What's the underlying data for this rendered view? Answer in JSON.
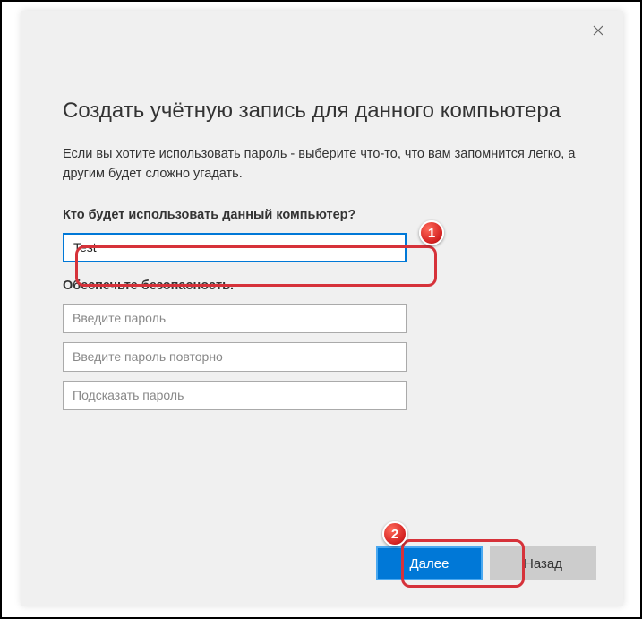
{
  "title": "Создать учётную запись для данного компьютера",
  "subtitle": "Если вы хотите использовать пароль - выберите что-то, что вам запомнится легко, а другим будет сложно угадать.",
  "username_label": "Кто будет использовать данный компьютер?",
  "username_value": "Test",
  "security_label": "Обеспечьте безопасность.",
  "password_placeholder": "Введите пароль",
  "password_confirm_placeholder": "Введите пароль повторно",
  "password_hint_placeholder": "Подсказать пароль",
  "buttons": {
    "next": "Далее",
    "back": "Назад"
  },
  "annotations": {
    "badge1": "1",
    "badge2": "2"
  }
}
